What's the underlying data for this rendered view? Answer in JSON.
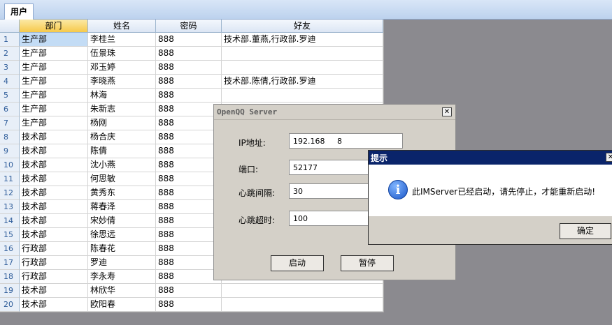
{
  "tab": "用户",
  "grid": {
    "columns": [
      "部门",
      "姓名",
      "密码",
      "好友"
    ],
    "rows": [
      [
        "1",
        "生产部",
        "李桂兰",
        "888",
        "技术部.董燕,行政部.罗迪"
      ],
      [
        "2",
        "生产部",
        "伍景珠",
        "888",
        ""
      ],
      [
        "3",
        "生产部",
        "邓玉婷",
        "888",
        ""
      ],
      [
        "4",
        "生产部",
        "李晓燕",
        "888",
        "技术部.陈倩,行政部.罗迪"
      ],
      [
        "5",
        "生产部",
        "林海",
        "888",
        ""
      ],
      [
        "6",
        "生产部",
        "朱新志",
        "888",
        ""
      ],
      [
        "7",
        "生产部",
        "杨刚",
        "888",
        ""
      ],
      [
        "8",
        "技术部",
        "杨合庆",
        "888",
        ""
      ],
      [
        "9",
        "技术部",
        "陈倩",
        "888",
        ""
      ],
      [
        "10",
        "技术部",
        "沈小燕",
        "888",
        ""
      ],
      [
        "11",
        "技术部",
        "何思敏",
        "888",
        ""
      ],
      [
        "12",
        "技术部",
        "黄秀东",
        "888",
        ""
      ],
      [
        "13",
        "技术部",
        "蒋春泽",
        "888",
        ""
      ],
      [
        "14",
        "技术部",
        "宋妙倩",
        "888",
        ""
      ],
      [
        "15",
        "技术部",
        "徐思远",
        "888",
        ""
      ],
      [
        "16",
        "行政部",
        "陈春花",
        "888",
        ""
      ],
      [
        "17",
        "行政部",
        "罗迪",
        "888",
        ""
      ],
      [
        "18",
        "行政部",
        "李永寿",
        "888",
        ""
      ],
      [
        "19",
        "技术部",
        "林欣华",
        "888",
        ""
      ],
      [
        "20",
        "技术部",
        "欧阳春",
        "888",
        ""
      ]
    ]
  },
  "server_dialog": {
    "title": "OpenQQ Server",
    "close": "✕",
    "ip_label": "IP地址:",
    "ip_value": "192.168.   .98",
    "port_label": "端口:",
    "port_value": "52177",
    "heartbeat_interval_label": "心跳间隔:",
    "heartbeat_interval_value": "30",
    "heartbeat_timeout_label": "心跳超时:",
    "heartbeat_timeout_value": "100",
    "start_label": "启动",
    "pause_label": "暂停"
  },
  "message_box": {
    "title": "提示",
    "close": "✕",
    "icon": "i",
    "message": "此IMServer已经启动，请先停止，才能重新启动!",
    "ok_label": "确定"
  }
}
